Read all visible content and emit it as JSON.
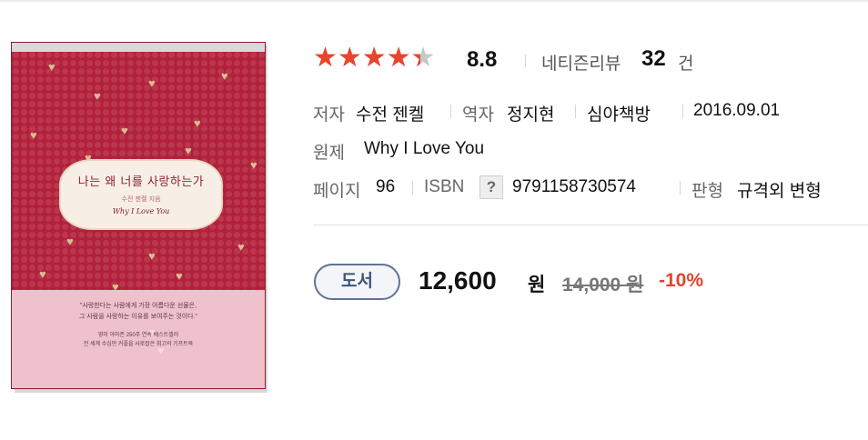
{
  "book": {
    "cover": {
      "title": "나는 왜 너를 사랑하는가",
      "author_line": "수전 젠켈 지음",
      "english_title": "Why I Love You",
      "lines": [
        "\"사랑한다는 사람에게 가장 아름다운 선물은,",
        "그 사람을 사랑하는 이유를 보여주는 것이다.\"",
        "영미 아마존 250주 연속 베스트셀러",
        "전 세계 수십만 커플을 사로잡은 최고의 기프트북"
      ]
    },
    "rating": {
      "score": "8.8",
      "stars_fraction": 0.88,
      "stars_glyphs": "★★★★★",
      "review_label": "네티즌리뷰",
      "review_count": "32",
      "review_unit": "건"
    },
    "details": {
      "author_label": "저자",
      "author": "수전 젠켈",
      "translator_label": "역자",
      "translator": "정지현",
      "publisher": "심야책방",
      "date": "2016.09.01",
      "original_label": "원제",
      "original_title": "Why I Love You",
      "pages_label": "페이지",
      "pages": "96",
      "isbn_label": "ISBN",
      "isbn_help": "?",
      "isbn": "9791158730574",
      "format_label": "판형",
      "format": "규격외 변형"
    },
    "price": {
      "badge": "도서",
      "sale_price": "12,600",
      "unit": "원",
      "original_price": "14,000 원",
      "discount": "-10%"
    }
  },
  "colors": {
    "star": "#e8452c",
    "discount": "#e0452c",
    "badge_border": "#5e7396",
    "cover_red": "#b2203a"
  }
}
